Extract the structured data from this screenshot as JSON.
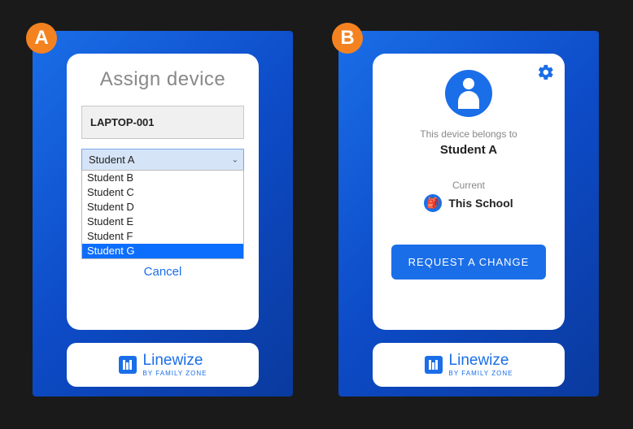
{
  "badges": {
    "a": "A",
    "b": "B"
  },
  "panelA": {
    "title": "Assign device",
    "deviceValue": "LAPTOP-001",
    "selected": "Student A",
    "options": [
      "Student B",
      "Student C",
      "Student D",
      "Student E",
      "Student F",
      "Student G"
    ],
    "highlightedIndex": 5,
    "cancel": "Cancel"
  },
  "panelB": {
    "belongsLabel": "This device belongs to",
    "ownerName": "Student A",
    "currentLabel": "Current",
    "schoolName": "This School",
    "requestLabel": "REQUEST A CHANGE"
  },
  "footer": {
    "brand": "Linewize",
    "tagline": "BY FAMILY ZONE"
  }
}
